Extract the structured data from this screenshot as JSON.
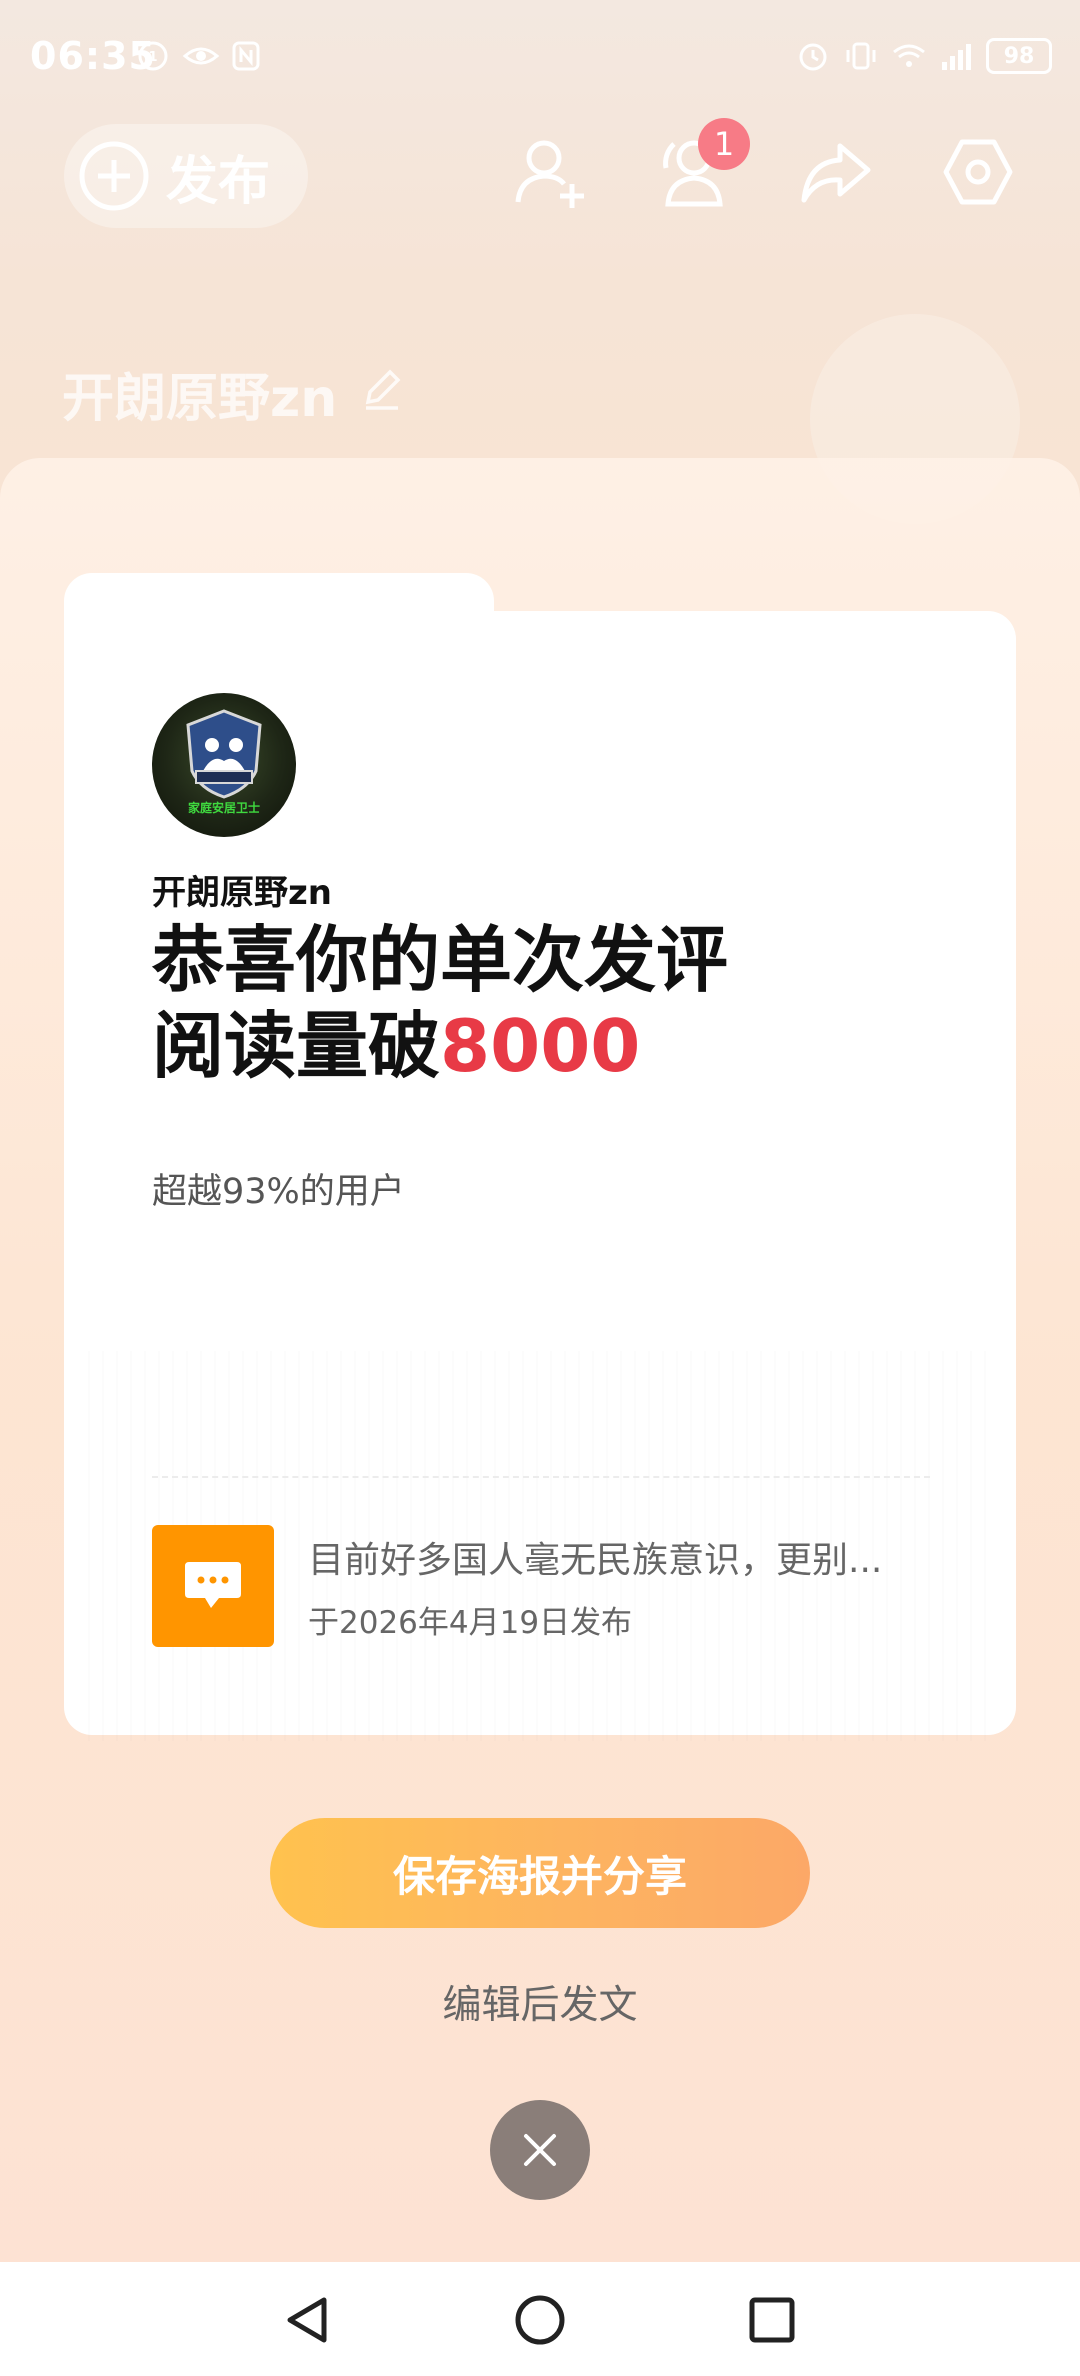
{
  "status_bar": {
    "time": "06:35",
    "battery": "98",
    "icons": [
      "hd-icon",
      "eye-icon",
      "nfc-icon",
      "alarm-icon",
      "vibrate-icon",
      "wifi-icon",
      "signal-4g-icon",
      "battery-icon"
    ]
  },
  "header": {
    "publish_label": "发布",
    "notification_count": "1",
    "profile_name": "开朗原野zn",
    "icons": [
      "add-friend-icon",
      "visitor-icon",
      "share-icon",
      "settings-icon"
    ]
  },
  "card": {
    "username": "开朗原野zn",
    "avatar_caption": "家庭安居卫士",
    "headline_line1": "恭喜你的单次发评",
    "headline_line2_prefix": "阅读量破",
    "headline_number": "8000",
    "percent_text": "超越93%的用户",
    "comment_text": "目前好多国人毫无民族意识，更别...",
    "comment_date": "于2026年4月19日发布"
  },
  "actions": {
    "save_share_label": "保存海报并分享",
    "edit_post_label": "编辑后发文"
  },
  "colors": {
    "accent_red": "#e83a46",
    "button_gradient_start": "#ffc24e",
    "button_gradient_end": "#fca867",
    "comment_icon_bg": "#ff9500",
    "badge": "#f77b86"
  }
}
